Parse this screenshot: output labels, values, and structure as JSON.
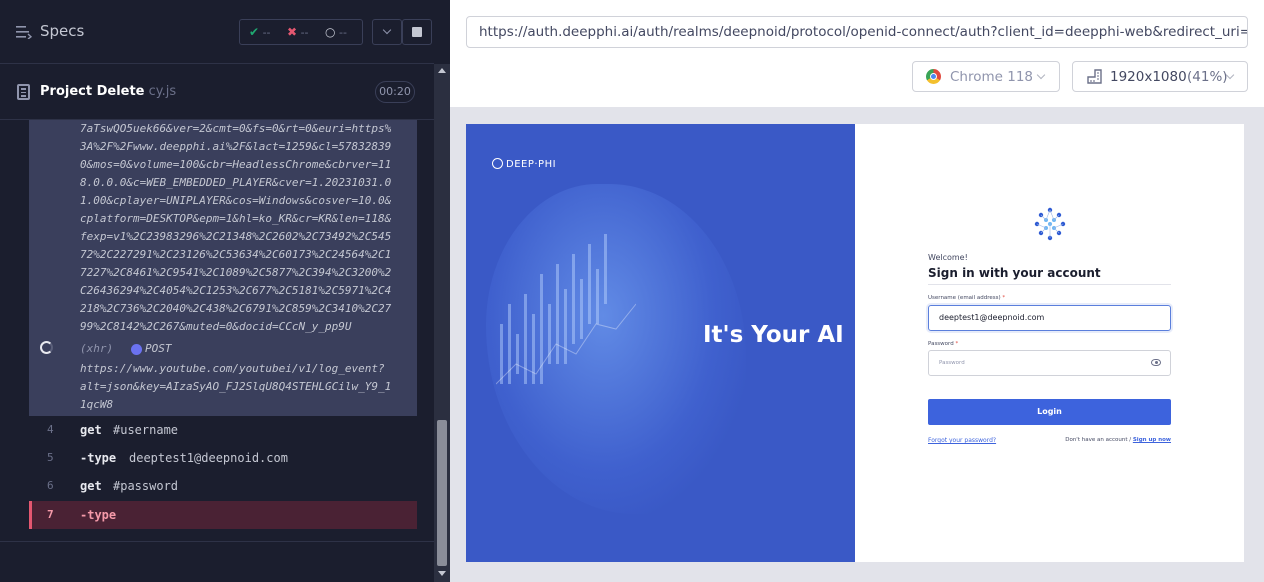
{
  "reporter": {
    "specs_label": "Specs",
    "stats": {
      "passed": "--",
      "failed": "--",
      "pending": "--"
    },
    "spec_file": {
      "name": "Project Delete",
      "ext": " cy.js"
    },
    "timer": "00:20"
  },
  "command_log": {
    "prev_url_lines": [
      "7aTswQO5uek66&ver=2&cmt=0&fs=0&rt=0&euri=https%",
      "3A%2F%2Fwww.deepphi.ai%2F&lact=1259&cl=57832839",
      "0&mos=0&volume=100&cbr=HeadlessChrome&cbrver=11",
      "8.0.0.0&c=WEB_EMBEDDED_PLAYER&cver=1.20231031.0",
      "1.00&cplayer=UNIPLAYER&cos=Windows&cosver=10.0&",
      "cplatform=DESKTOP&epm=1&hl=ko_KR&cr=KR&len=118&",
      "fexp=v1%2C23983296%2C21348%2C2602%2C73492%2C545",
      "72%2C227291%2C23126%2C53634%2C60173%2C24564%2C1",
      "7227%2C8461%2C9541%2C1089%2C5877%2C394%2C3200%2",
      "C26436294%2C4054%2C1253%2C677%2C5181%2C5971%2C4",
      "218%2C736%2C2040%2C438%2C6791%2C859%2C3410%2C27",
      "99%2C8142%2C267&muted=0&docid=CCcN_y_pp9U"
    ],
    "xhr": {
      "label": "(xhr)",
      "method": "POST",
      "url_lines": [
        "https://www.youtube.com/youtubei/v1/log_event?",
        "alt=json&key=AIzaSyAO_FJ2SlqU8Q4STEHLGCilw_Y9_1",
        "1qcW8"
      ]
    },
    "commands": [
      {
        "num": "4",
        "name": "get",
        "arg": "#username"
      },
      {
        "num": "5",
        "name": "-type",
        "arg": "deeptest1@deepnoid.com"
      },
      {
        "num": "6",
        "name": "get",
        "arg": "#password"
      },
      {
        "num": "7",
        "name": "-type",
        "arg": ""
      }
    ]
  },
  "browser": {
    "url": "https://auth.deepphi.ai/auth/realms/deepnoid/protocol/openid-connect/auth?client_id=deepphi-web&redirect_uri=https",
    "name": "Chrome 118",
    "viewport": "1920x1080",
    "zoom": "(41%)"
  },
  "aut": {
    "logo_text": "DEEP·PHI",
    "hero_title": "It's Your AI",
    "welcome": "Welcome!",
    "sign_in_title": "Sign in with your account",
    "username_label": "Username (email address)",
    "username_value": "deeptest1@deepnoid.com",
    "password_label": "Password",
    "password_placeholder": "Password",
    "login_button": "Login",
    "forgot": "Forgot your password?",
    "no_account": "Don't have an account / ",
    "signup": "Sign up now",
    "required_mark": "*"
  },
  "colors": {
    "reporter_bg": "#1b1e2e",
    "failed_accent": "#e45770",
    "hero_blue": "#3a59c6",
    "login_button": "#3d63dd"
  }
}
